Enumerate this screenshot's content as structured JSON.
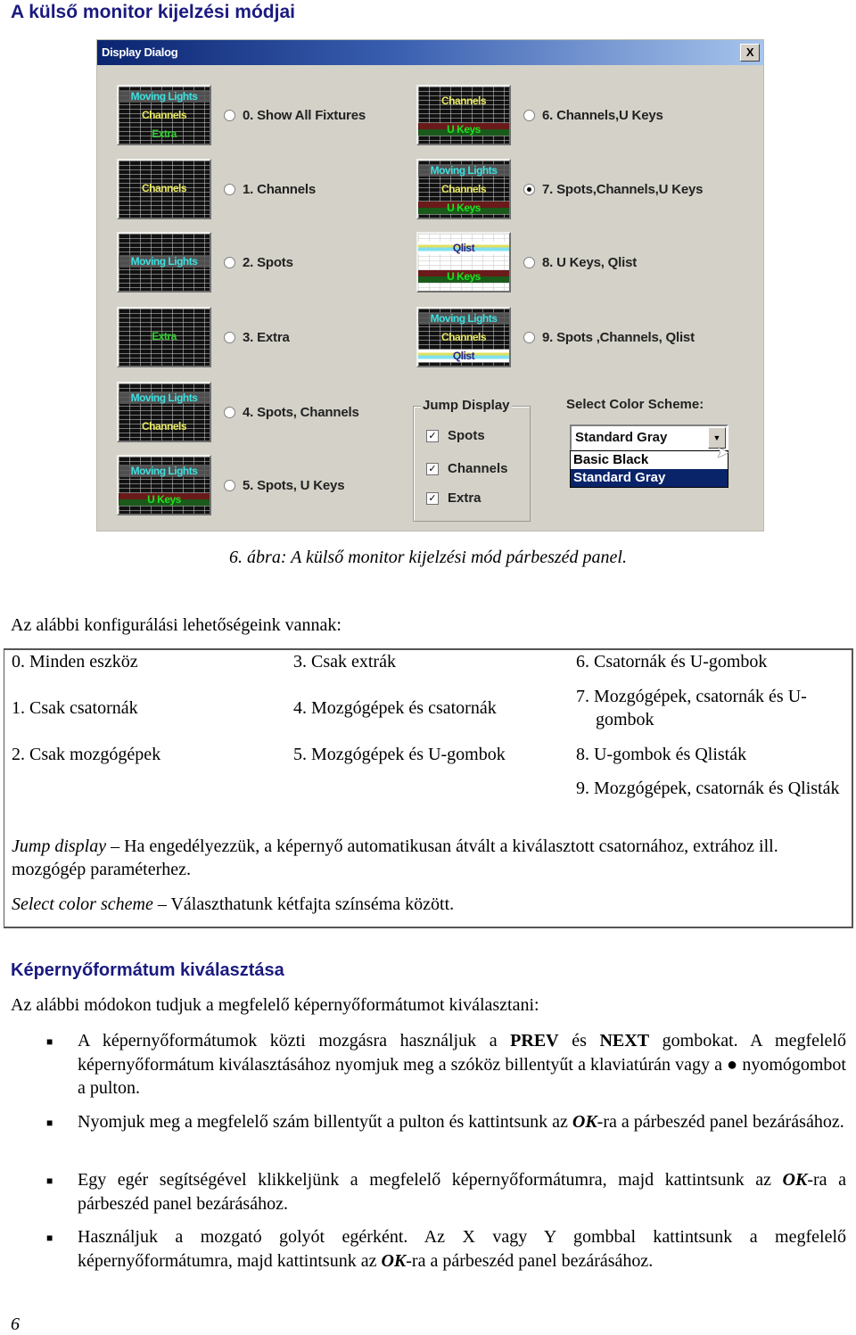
{
  "heading": "A külső monitor kijelzési módjai",
  "dialog": {
    "title": "Display Dialog",
    "close_label": "X",
    "options": [
      {
        "label": "0. Show All Fixtures",
        "selected": false,
        "thumb": [
          "Moving Lights",
          "Channels",
          "Extra"
        ]
      },
      {
        "label": "1. Channels",
        "selected": false,
        "thumb": [
          "Channels"
        ]
      },
      {
        "label": "2. Spots",
        "selected": false,
        "thumb": [
          "Moving Lights"
        ]
      },
      {
        "label": "3. Extra",
        "selected": false,
        "thumb": [
          "Extra"
        ]
      },
      {
        "label": "4. Spots, Channels",
        "selected": false,
        "thumb": [
          "Moving Lights",
          "Channels"
        ]
      },
      {
        "label": "5. Spots, U Keys",
        "selected": false,
        "thumb": [
          "Moving Lights",
          "U Keys"
        ]
      },
      {
        "label": "6. Channels,U Keys",
        "selected": false,
        "thumb": [
          "Channels",
          "U Keys"
        ]
      },
      {
        "label": "7. Spots,Channels,U Keys",
        "selected": true,
        "thumb": [
          "Moving Lights",
          "Channels",
          "U Keys"
        ]
      },
      {
        "label": "8. U Keys, Qlist",
        "selected": false,
        "thumb": [
          "Qlist",
          "U Keys"
        ]
      },
      {
        "label": "9. Spots ,Channels, Qlist",
        "selected": false,
        "thumb": [
          "Moving Lights",
          "Channels",
          "Qlist"
        ]
      }
    ],
    "jump_display": {
      "title": "Jump Display",
      "checkboxes": [
        {
          "label": "Spots",
          "checked": true
        },
        {
          "label": "Channels",
          "checked": true
        },
        {
          "label": "Extra",
          "checked": true
        }
      ]
    },
    "color_scheme": {
      "label": "Select Color Scheme:",
      "value": "Standard Gray",
      "options": [
        "Basic Black",
        "Standard Gray"
      ],
      "highlighted": "Standard Gray"
    }
  },
  "caption": "6. ábra: A külső monitor kijelzési mód párbeszéd panel.",
  "intro": "Az alábbi konfigurálási lehetőségeink vannak:",
  "config_table": {
    "col1": [
      "0. Minden eszköz",
      "1. Csak csatornák",
      "2. Csak mozgógépek"
    ],
    "col2": [
      "3. Csak extrák",
      "4. Mozgógépek és csatornák",
      "5. Mozgógépek és U-gombok"
    ],
    "col3": [
      "6. Csatornák és U-gombok",
      "7. Mozgógépek, csatornák és U-gombok",
      "8. U-gombok és Qlisták",
      "9. Mozgógépek, csatornák és Qlisták"
    ],
    "jump_term": "Jump display",
    "jump_desc": " – Ha engedélyezzük, a képernyő automatikusan átvált a kiválasztott csatornához, extrához ill. mozgógép paraméterhez.",
    "scheme_term": "Select color scheme",
    "scheme_desc": " – Választhatunk kétfajta színséma között."
  },
  "section2": {
    "heading": "Képernyőformátum kiválasztása",
    "intro": "Az alábbi módokon tudjuk a megfelelő képernyőformátumot kiválasztani:",
    "bullets": [
      {
        "pre": "A képernyőformátumok közti mozgásra használjuk a ",
        "b1": "PREV",
        "mid": " és ",
        "b2": "NEXT",
        "post": " gombokat. A megfelelő képernyőformátum kiválasztásához nyomjuk meg a szóköz billentyűt a klaviatúrán vagy a ● nyomógombot a pulton."
      },
      {
        "pre": "Nyomjuk meg a megfelelő szám billentyűt a pulton és kattintsunk az ",
        "b1": "OK",
        "post": "-ra a párbeszéd panel bezárásához."
      },
      {
        "pre": "Egy egér segítségével klikkeljünk a megfelelő képernyőformátumra, majd kattintsunk az ",
        "b1": "OK",
        "post": "-ra a párbeszéd panel bezárásához."
      },
      {
        "pre": "Használjuk a mozgató golyót egérként. Az X vagy Y gombbal kattintsunk a megfelelő képernyőformátumra, majd kattintsunk az ",
        "b1": "OK",
        "post": "-ra a párbeszéd panel bezárásához."
      }
    ]
  },
  "page_number": "6",
  "colors": {
    "heading": "#1a1a80",
    "dialog_bg": "#d4d2c8",
    "titlebar_start": "#0a2470",
    "titlebar_end": "#a6c4ec",
    "selection": "#0a246a",
    "moving_lights": "#3de0e0",
    "channels": "#e8e860",
    "extra": "#30d030",
    "u_keys": "#20e020",
    "qlist": "#302080"
  }
}
